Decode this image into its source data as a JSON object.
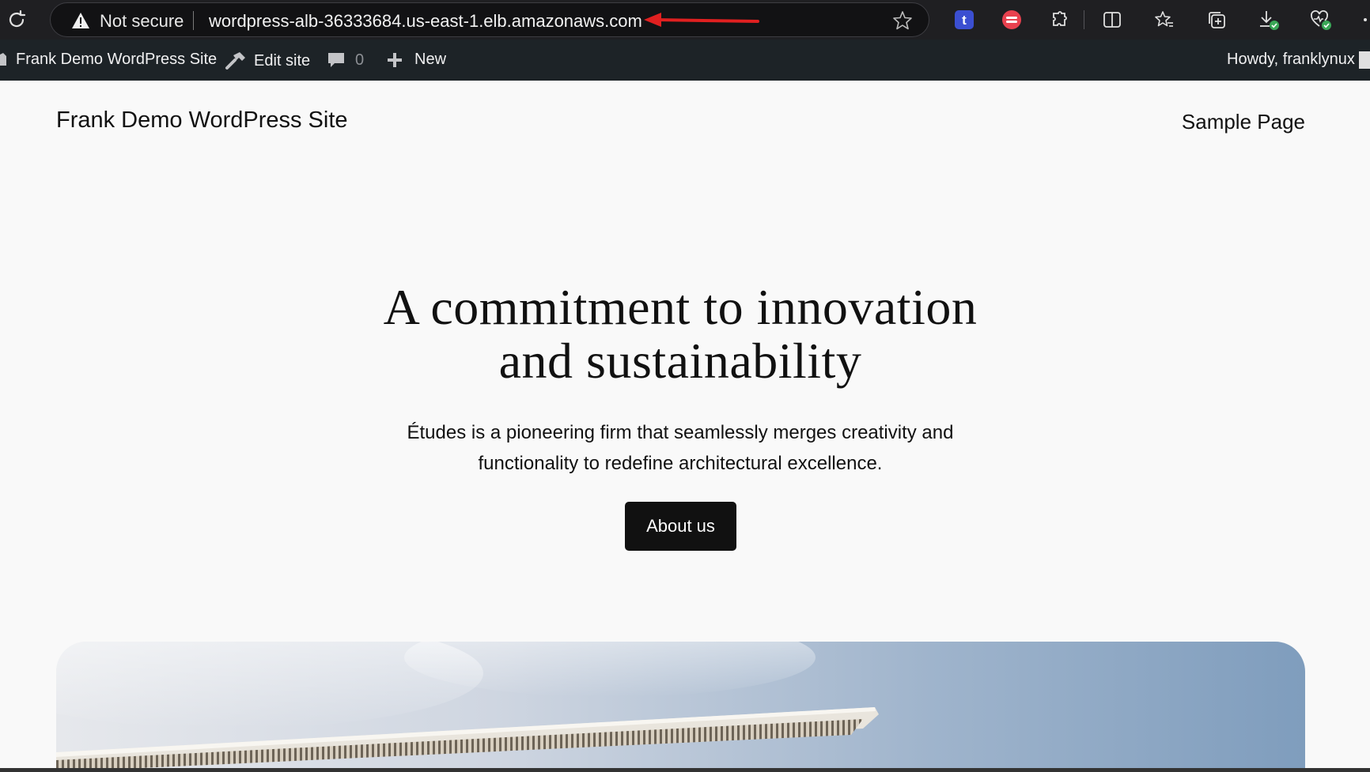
{
  "browser": {
    "security_label": "Not secure",
    "url": "wordpress-alb-36333684.us-east-1.elb.amazonaws.com",
    "extensions": [
      "toggl-t-icon",
      "red-extension-icon",
      "extensions-puzzle-icon",
      "split-screen-icon",
      "favorites-icon",
      "collections-icon",
      "downloads-icon",
      "browser-essentials-icon"
    ]
  },
  "admin_bar": {
    "site_name": "Frank Demo WordPress Site",
    "edit_site": "Edit site",
    "comments_count": "0",
    "new_label": "New",
    "howdy": "Howdy, franklynux"
  },
  "site": {
    "title": "Frank Demo WordPress Site",
    "nav": [
      "Sample Page"
    ]
  },
  "hero": {
    "title_line1": "A commitment to innovation",
    "title_line2": "and sustainability",
    "sub_line1": "Études is a pioneering firm that seamlessly merges creativity and",
    "sub_line2": "functionality to redefine architectural excellence.",
    "button_label": "About us"
  },
  "colors": {
    "browser_bg": "#1f1f22",
    "admin_bar_bg": "#1d2327",
    "page_bg": "#f9f9f9",
    "button_bg": "#111111",
    "annotation_arrow": "#e02020"
  }
}
